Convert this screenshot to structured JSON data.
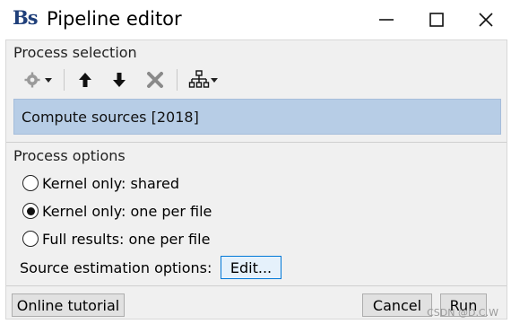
{
  "window": {
    "logo": "Bs",
    "title": "Pipeline editor"
  },
  "sections": {
    "selection_title": "Process selection",
    "options_title": "Process options"
  },
  "toolbar": {
    "icons": [
      "gear-icon",
      "chevron-down-icon",
      "arrow-up-icon",
      "arrow-down-icon",
      "delete-icon",
      "tree-icon",
      "chevron-down-icon"
    ]
  },
  "process_list": {
    "items": [
      {
        "label": "Compute sources [2018]",
        "selected": true
      }
    ]
  },
  "options": {
    "radios": [
      {
        "label": "Kernel only: shared",
        "checked": false
      },
      {
        "label": "Kernel only: one per file",
        "checked": true
      },
      {
        "label": "Full results: one per file",
        "checked": false
      }
    ],
    "source_label": "Source estimation options:",
    "edit_label": "Edit..."
  },
  "footer": {
    "tutorial_label": "Online tutorial",
    "cancel_label": "Cancel",
    "run_label": "Run"
  },
  "watermark": "CSDN @D.C.W",
  "colors": {
    "selection_bg": "#b7cde6",
    "panel_bg": "#f0f0f0",
    "logo": "#1f3f7a"
  }
}
